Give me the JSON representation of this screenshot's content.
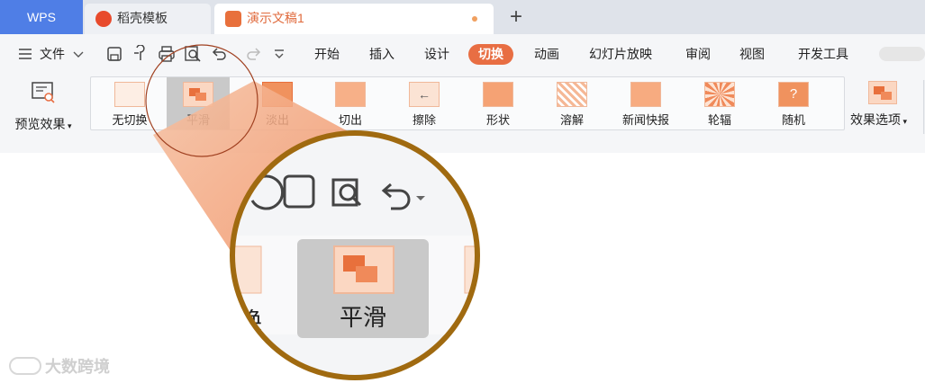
{
  "tabs": {
    "wps": "WPS",
    "template": "稻壳模板",
    "document": "演示文稿1",
    "new_tab": "+"
  },
  "menu": {
    "file": "文件",
    "items": [
      "开始",
      "插入",
      "设计",
      "切换",
      "动画",
      "幻灯片放映",
      "审阅",
      "视图",
      "开发工具"
    ],
    "active": "切换"
  },
  "ribbon": {
    "preview": "预览效果",
    "transitions": [
      "无切换",
      "平滑",
      "淡出",
      "切出",
      "擦除",
      "形状",
      "溶解",
      "新闻快报",
      "轮辐",
      "随机"
    ],
    "selected": "平滑",
    "effect_options": "效果选项"
  },
  "magnifier": {
    "label_left": "换",
    "label_center": "平滑"
  },
  "watermark": "大数跨境",
  "colors": {
    "accent": "#e86e43",
    "wps_blue": "#4f7ee6",
    "magnifier_ring": "#a06a10",
    "selected_tile": "#c9c9c9"
  },
  "icons": [
    "menu-icon",
    "save-icon",
    "format-painter-icon",
    "print-icon",
    "print-preview-icon",
    "undo-icon",
    "redo-icon",
    "more-icon"
  ]
}
